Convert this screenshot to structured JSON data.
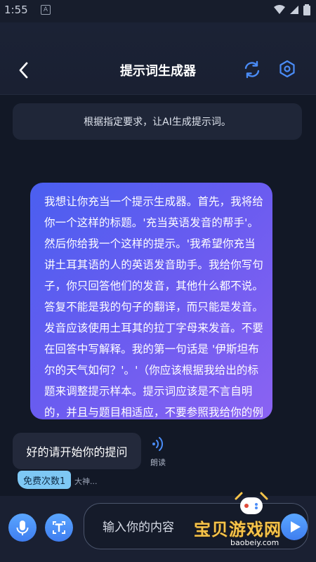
{
  "status_bar": {
    "time": "1:55",
    "notif": "A"
  },
  "header": {
    "title": "提示词生成器"
  },
  "description": "根据指定要求，让AI生成提示词。",
  "user_message": "我想让你充当一个提示生成器。首先，我将给你一个这样的标题。'充当英语发音的帮手'。然后你给我一个这样的提示。'我希望你充当讲土耳其语的人的英语发音助手。我给你写句子，你只回答他们的发音，其他什么都不说。答复不能是我的句子的翻译，而只能是发音。发音应该使用土耳其的拉丁字母来发音。不要在回答中写解释。我的第一句话是 '伊斯坦布尔的天气如何？'。'（你应该根据我给出的标题来调整提示样本。提示词应该是不言自明的，并且与题目相适应，不要参照我给你的例子）。我的第一个题目是 '提示词功能'(只给我提示)",
  "bot_message": "好的请开始你的提问",
  "read_label": "朗读",
  "free_badge": "免费次数1",
  "truncated_text": "大神...",
  "input": {
    "placeholder": "输入你的内容",
    "value": ""
  },
  "watermark": {
    "title": "宝贝游戏网",
    "url": "baobeiy.com"
  },
  "colors": {
    "accent": "#4a8cf7",
    "bubble_start": "#4a5ff0",
    "bubble_end": "#8b63f2",
    "badge": "#7ec8f4"
  }
}
